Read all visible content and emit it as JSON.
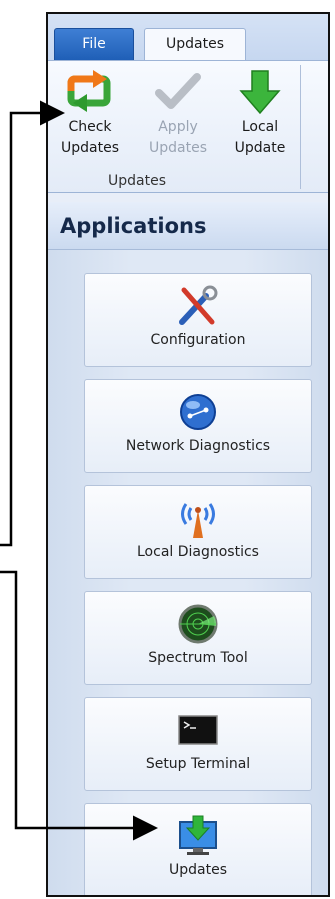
{
  "tabs": [
    {
      "label": "File"
    },
    {
      "label": "Updates"
    }
  ],
  "ribbon": {
    "buttons": [
      {
        "label": "Check\nUpdates",
        "icon": "refresh-arrows-icon"
      },
      {
        "label": "Apply\nUpdates",
        "icon": "checkmark-icon",
        "disabled": true
      },
      {
        "label": "Local\nUpdate",
        "icon": "download-arrow-icon"
      }
    ],
    "group_label": "Updates"
  },
  "applications": {
    "title": "Applications",
    "items": [
      {
        "label": "Configuration",
        "icon": "tools-icon"
      },
      {
        "label": "Network Diagnostics",
        "icon": "network-globe-icon"
      },
      {
        "label": "Local Diagnostics",
        "icon": "antenna-icon"
      },
      {
        "label": "Spectrum Tool",
        "icon": "radar-icon"
      },
      {
        "label": "Setup Terminal",
        "icon": "terminal-icon"
      },
      {
        "label": "Updates",
        "icon": "monitor-download-icon"
      }
    ]
  },
  "colors": {
    "file_tab": "#1f5fb7",
    "panel_bg": "#dfe8f5",
    "header_text": "#15294a"
  }
}
